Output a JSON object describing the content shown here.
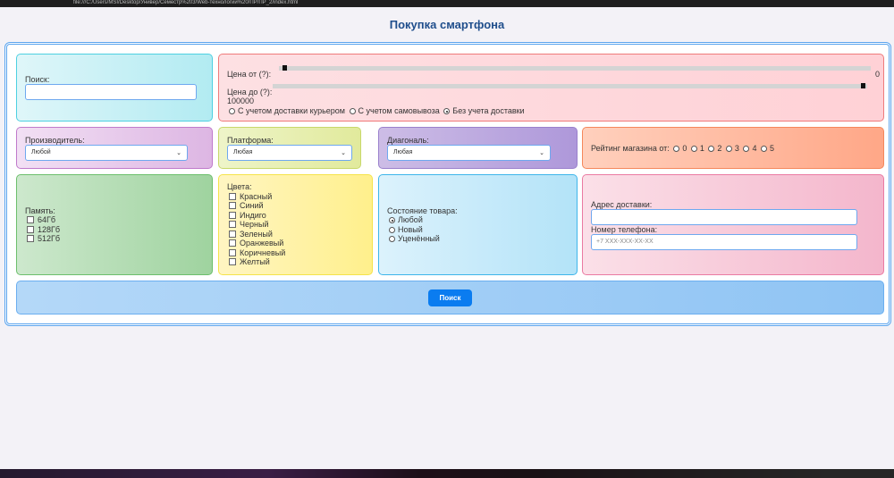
{
  "browser": {
    "url": "file:///C:/Users/MSI/Desktop/Универ/Семестр%203/Web-технологии%20/ПР/ПР_2/index.html"
  },
  "title": "Покупка смартфона",
  "search": {
    "label": "Поиск:",
    "value": ""
  },
  "price": {
    "from_label": "Цена от (?):",
    "from_value": "0",
    "from_fraction": 0,
    "to_label": "Цена до (?):",
    "to_value": "100000",
    "to_fraction": 1,
    "delivery": [
      {
        "label": "С учетом доставки курьером",
        "checked": false
      },
      {
        "label": "С учетом самовывоза",
        "checked": false
      },
      {
        "label": "Без учета доставки",
        "checked": true
      }
    ]
  },
  "manufacturer": {
    "label": "Производитель:",
    "value": "Любой"
  },
  "platform": {
    "label": "Платформа:",
    "value": "Любая"
  },
  "diagonal": {
    "label": "Диагональ:",
    "value": "Любая"
  },
  "rating": {
    "label": "Рейтинг магазина от:",
    "options": [
      "0",
      "1",
      "2",
      "3",
      "4",
      "5"
    ]
  },
  "memory": {
    "label": "Память:",
    "options": [
      "64Гб",
      "128Гб",
      "512Гб"
    ]
  },
  "colors": {
    "label": "Цвета:",
    "options": [
      "Красный",
      "Синий",
      "Индиго",
      "Черный",
      "Зеленый",
      "Оранжевый",
      "Коричневый",
      "Желтый"
    ]
  },
  "condition": {
    "label": "Состояние товара:",
    "options": [
      {
        "label": "Любой",
        "checked": true
      },
      {
        "label": "Новый",
        "checked": false
      },
      {
        "label": "Уценённый",
        "checked": false
      }
    ]
  },
  "address": {
    "label": "Адрес доставки:",
    "value": ""
  },
  "phone": {
    "label": "Номер телефона:",
    "placeholder": "+7 XXX-XXX-XX-XX"
  },
  "submit": "Поиск"
}
